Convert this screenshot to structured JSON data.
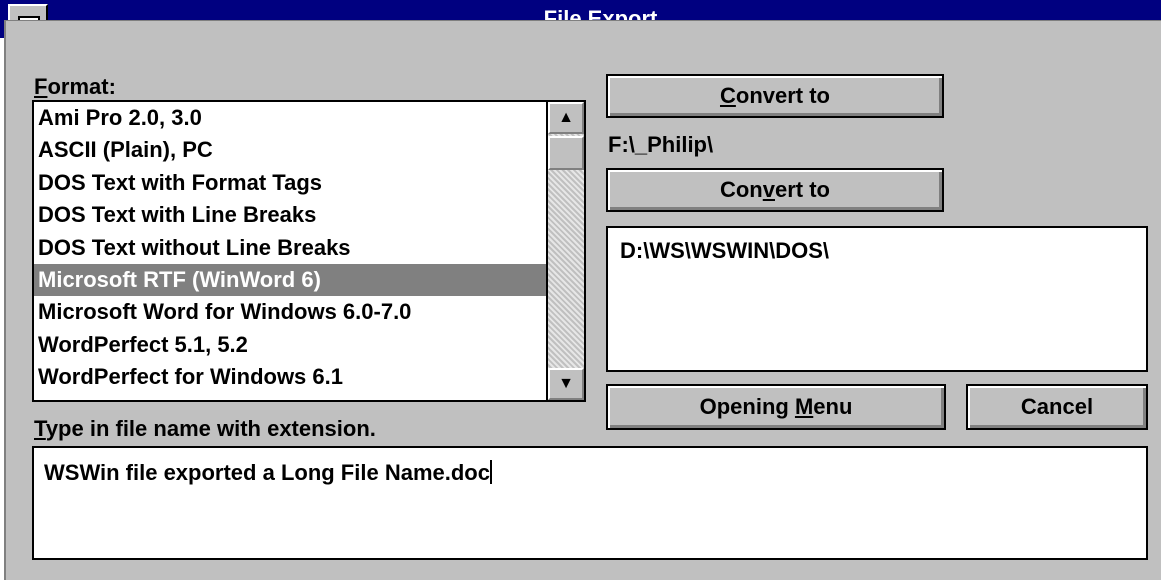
{
  "window": {
    "title": "File Export"
  },
  "format_label_prefix": "F",
  "format_label_rest": "ormat:",
  "formats": [
    "Ami Pro 2.0, 3.0",
    "ASCII (Plain), PC",
    "DOS Text with Format Tags",
    "DOS Text with Line Breaks",
    "DOS Text without Line Breaks",
    "Microsoft RTF (WinWord 6)",
    "Microsoft Word for Windows 6.0-7.0",
    "WordPerfect 5.1, 5.2",
    "WordPerfect for Windows 6.1"
  ],
  "selected_format": "Microsoft RTF (WinWord 6)",
  "convert_to_1": {
    "accel": "C",
    "rest": "onvert to"
  },
  "path_1": "F:\\_Philip\\",
  "convert_to_2": {
    "before": "Con",
    "accel": "v",
    "rest": "ert to"
  },
  "path_2": "D:\\WS\\WSWIN\\DOS\\",
  "opening_menu": {
    "before": "Opening ",
    "accel": "M",
    "rest": "enu"
  },
  "cancel_label": "Cancel",
  "filename_label": {
    "accel": "T",
    "rest": "ype in file name with extension."
  },
  "filename_value": "WSWin file exported a Long File Name.doc",
  "scroll_up_icon": "arrow-up",
  "scroll_down_icon": "arrow-down"
}
